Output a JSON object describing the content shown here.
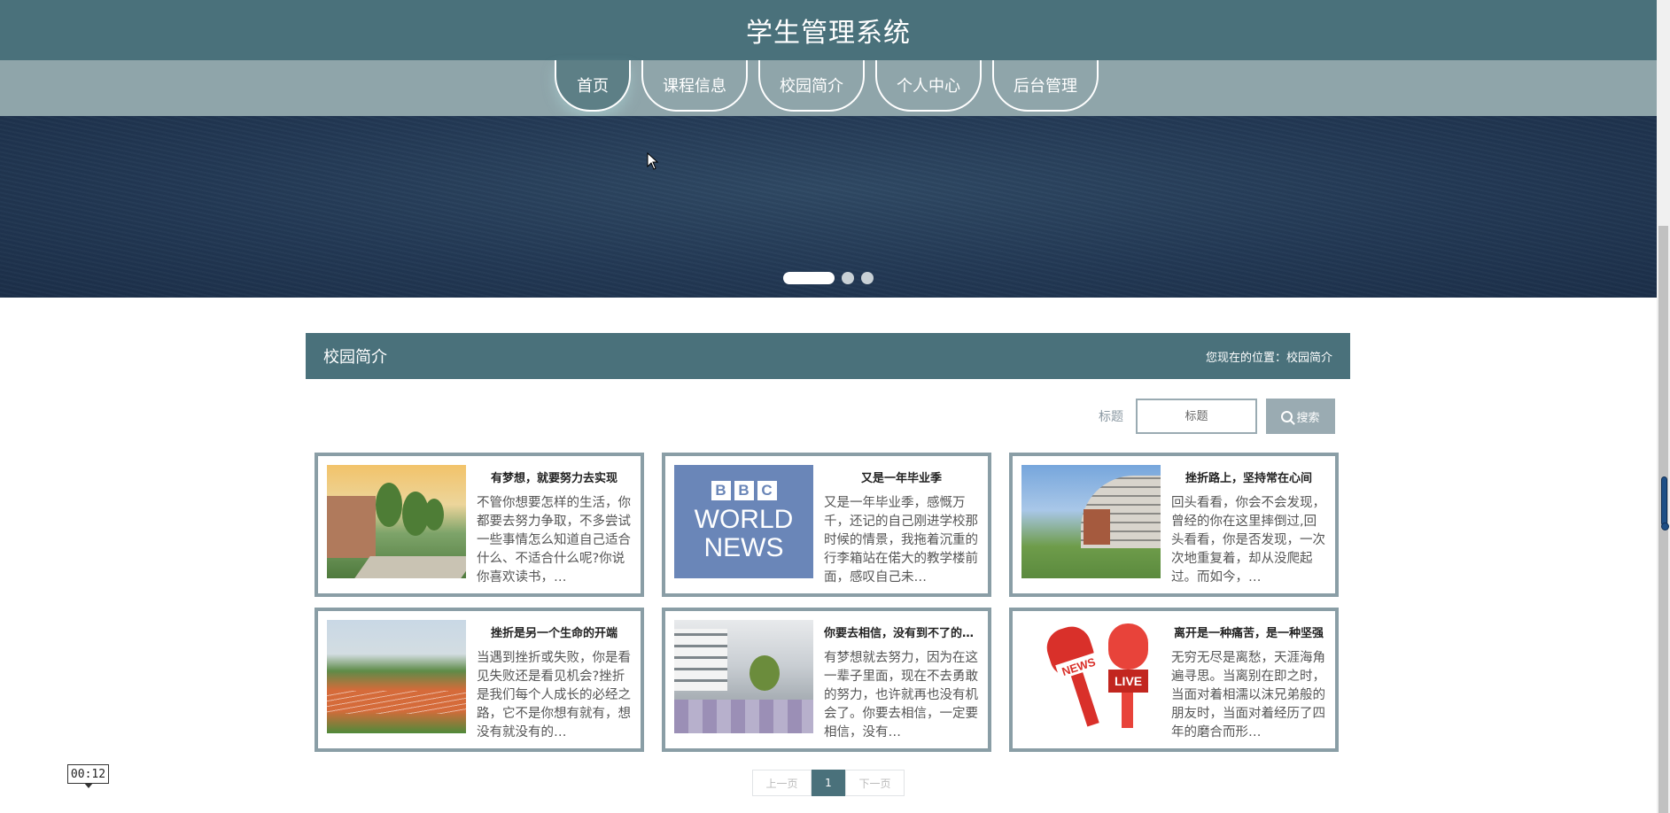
{
  "header": {
    "title": "学生管理系统"
  },
  "nav": {
    "items": [
      {
        "label": "首页"
      },
      {
        "label": "课程信息"
      },
      {
        "label": "校园简介"
      },
      {
        "label": "个人中心"
      },
      {
        "label": "后台管理"
      }
    ]
  },
  "banner": {
    "slide_count": 3,
    "active_slide": 1
  },
  "section": {
    "title": "校园简介",
    "breadcrumb": "您现在的位置：校园简介"
  },
  "search": {
    "label": "标题",
    "placeholder": "标题",
    "button_label": "搜索"
  },
  "cards": [
    {
      "title": "有梦想，就要努力去实现",
      "text": "不管你想要怎样的生活，你都要去努力争取，不多尝试一些事情怎么知道自己适合什么、不适合什么呢?你说你喜欢读书，…",
      "image": "campus-road-trees"
    },
    {
      "title": "又是一年毕业季",
      "text": "又是一年毕业季，感慨万千，还记的自己刚进学校那时候的情景，我拖着沉重的行李箱站在偌大的教学楼前面，感叹自己未…",
      "image": "bbc-world-news-logo"
    },
    {
      "title": "挫折路上，坚持常在心间",
      "text": "回头看看，你会不会发现，曾经的你在这里摔倒过,回头看看，你是否发现，一次次地重复着，却从没爬起过。而如今，…",
      "image": "campus-curved-building"
    },
    {
      "title": "挫折是另一个生命的开端",
      "text": "当遇到挫折或失败，你是看见失败还是看见机会?挫折是我们每个人成长的必经之路，它不是你想有就有，想没有就没有的…",
      "image": "running-track"
    },
    {
      "title": "你要去相信，没有到不了的明天",
      "text": "有梦想就去努力，因为在这一辈子里面，现在不去勇敢的努力，也许就再也没有机会了。你要去相信，一定要相信，没有…",
      "image": "modern-building-plaza"
    },
    {
      "title": "离开是一种痛苦，是一种坚强",
      "text": "无穷无尽是离愁，天涯海角遍寻思。当离别在即之时，当面对着相濡以沫兄弟般的朋友时，当面对着经历了四年的磨合而形…",
      "image": "news-live-microphones"
    }
  ],
  "thumb_text": {
    "bbc": [
      "B",
      "B",
      "C"
    ],
    "world": "WORLD",
    "news": "NEWS",
    "mic_news": "NEWS",
    "mic_live": "LIVE"
  },
  "pagination": {
    "prev": "上一页",
    "current": "1",
    "next": "下一页"
  },
  "overlay": {
    "timer": "00:12"
  },
  "colors": {
    "primary": "#4a717b",
    "nav_bg": "#8fa5aa",
    "banner": "#233955",
    "card_border": "#8a9ea6"
  }
}
